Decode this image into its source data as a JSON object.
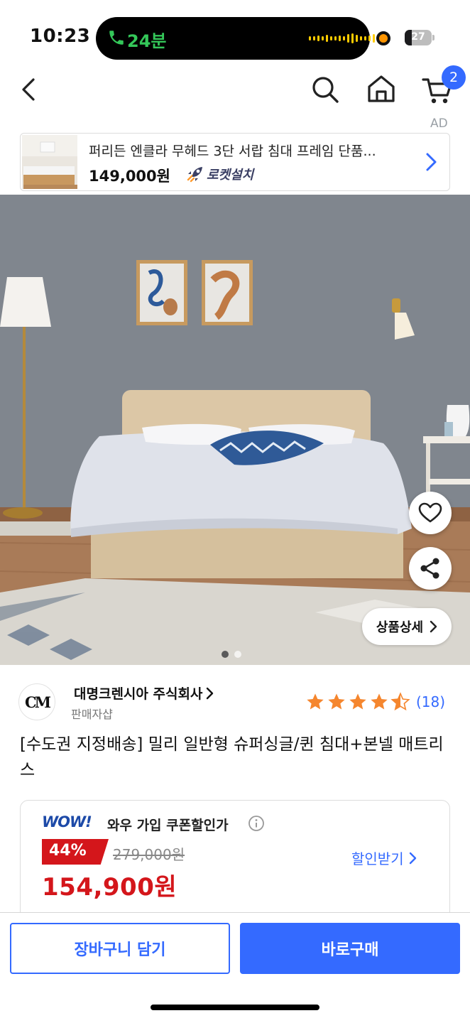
{
  "status_bar": {
    "time": "10:23",
    "call_duration": "24분",
    "battery_level": "27",
    "battery_fraction": 0.27
  },
  "nav": {
    "back_icon": "chevron-left-icon",
    "search_icon": "search-icon",
    "home_icon": "home-icon",
    "cart_icon": "cart-icon",
    "cart_count": "2"
  },
  "ad": {
    "label": "AD",
    "title": "퍼리든 엔클라 무헤드 3단 서랍 침대 프레임 단품...",
    "price": "149,000원",
    "delivery_badge": "로켓설치"
  },
  "gallery": {
    "detail_button_label": "상품상세",
    "current_image": 1,
    "image_count": 2
  },
  "seller": {
    "logo_text": "CM",
    "name": "대명크렌시아 주식회사",
    "type": "판매자샵",
    "rating": 4.5,
    "review_count": "(18)"
  },
  "product": {
    "title": "[수도권 지정배송] 밀리 일반형 슈퍼싱글/퀸 침대+본넬 매트리스"
  },
  "price": {
    "wow_logo": "WOW!",
    "wow_label": "와우 가입 쿠폰할인가",
    "discount": "44%",
    "original_price": "279,000원",
    "sale_price": "154,900원",
    "coupon_link": "할인받기"
  },
  "actions": {
    "add_to_cart": "장바구니 담기",
    "buy_now": "바로구매"
  },
  "colors": {
    "accent": "#346aff",
    "sale_red": "#d4161b"
  }
}
